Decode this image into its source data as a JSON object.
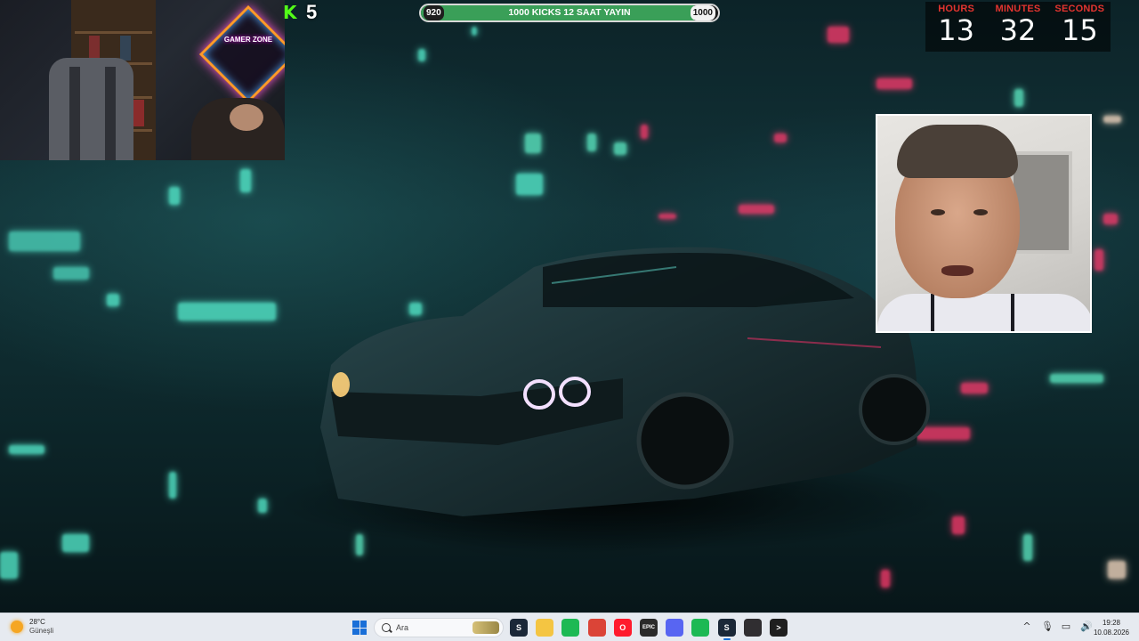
{
  "overlay": {
    "kick_count": "5",
    "goal": {
      "start": "920",
      "label": "1000 KICKS 12 SAAT YAYIN",
      "end": "1000",
      "progress_fraction": 0.92,
      "fill_color": "#3a9f58"
    },
    "timer": {
      "hours_label": "HOURS",
      "hours": "13",
      "minutes_label": "MINUTES",
      "minutes": "32",
      "seconds_label": "SECONDS",
      "seconds": "15",
      "label_color": "#e3342f"
    },
    "neon_sign_text": "GAMER ZONE"
  },
  "taskbar": {
    "weather": {
      "temp": "28°C",
      "desc": "Güneşli",
      "icon": "sun-icon"
    },
    "search_placeholder": "Ara",
    "apps": [
      {
        "name": "steam-icon",
        "color": "#1b2838",
        "glyph": "S"
      },
      {
        "name": "file-explorer-icon",
        "color": "#f4c542",
        "glyph": ""
      },
      {
        "name": "spotify-icon",
        "color": "#1db954",
        "glyph": ""
      },
      {
        "name": "chrome-icon",
        "color": "#db4437",
        "glyph": ""
      },
      {
        "name": "opera-icon",
        "color": "#ff1b2d",
        "glyph": "O"
      },
      {
        "name": "epic-games-icon",
        "color": "#2a2a2a",
        "glyph": "EPIC"
      },
      {
        "name": "discord-icon",
        "color": "#5865f2",
        "glyph": ""
      },
      {
        "name": "spotify-icon-2",
        "color": "#1db954",
        "glyph": ""
      },
      {
        "name": "steam-icon-2",
        "color": "#1b2838",
        "glyph": "S"
      },
      {
        "name": "obs-icon",
        "color": "#302e31",
        "glyph": ""
      },
      {
        "name": "terminal-icon",
        "color": "#1f1f1f",
        "glyph": ">"
      }
    ],
    "tray": {
      "chevron": "^",
      "mic": "🎙",
      "network": "▭",
      "volume": "🔊"
    },
    "clock": {
      "time": "19:28",
      "date": "10.08.2026"
    }
  }
}
